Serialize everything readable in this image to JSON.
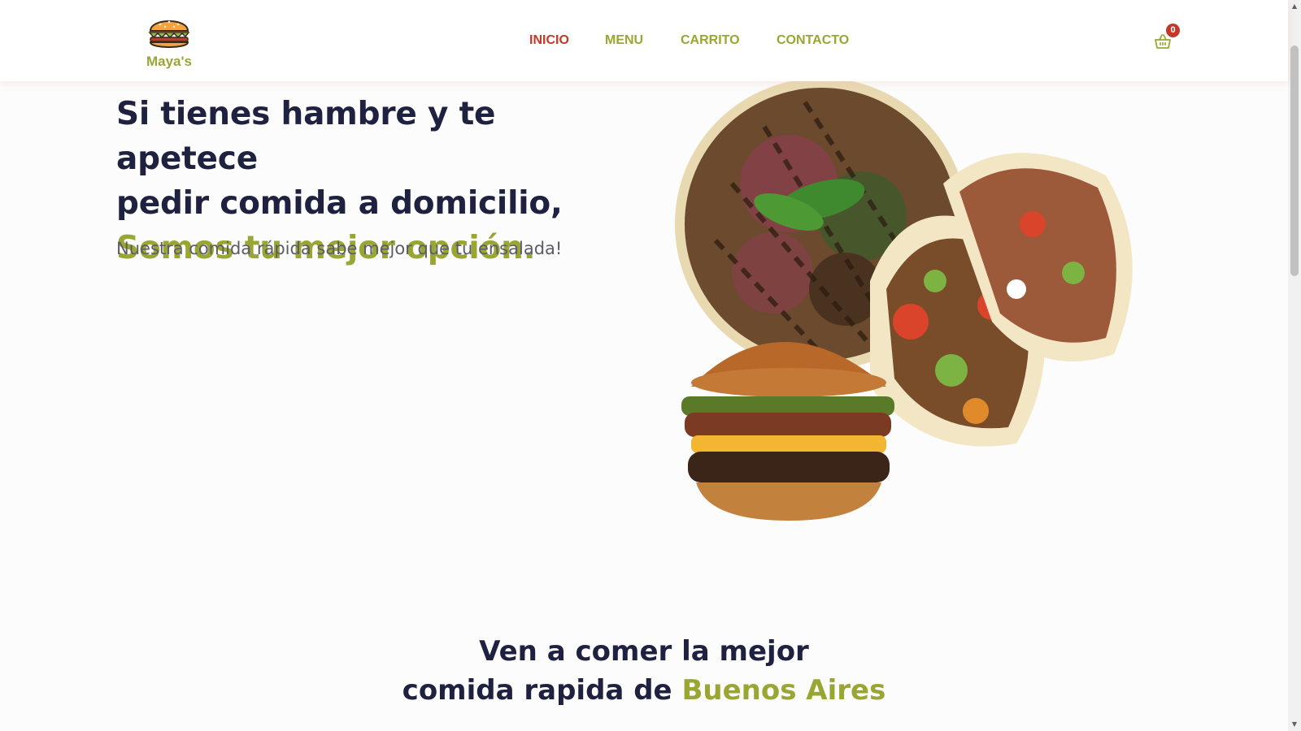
{
  "brand": {
    "name": "Maya's"
  },
  "nav": {
    "items": [
      {
        "label": "INICIO",
        "active": true
      },
      {
        "label": "MENU",
        "active": false
      },
      {
        "label": "CARRITO",
        "active": false
      },
      {
        "label": "CONTACTO",
        "active": false
      }
    ],
    "cart_count": "0"
  },
  "hero": {
    "title_line1": "Si tienes hambre y te apetece",
    "title_line2": "pedir comida a domicilio,",
    "title_accent": "Somos tu mejor opción.",
    "subtitle": "Nuestra comida rápida sabe mejor que tu ensalada!"
  },
  "section": {
    "title_line1": "Ven a comer la mejor",
    "title_line2_prefix": "comida rapida de ",
    "title_line2_accent": "Buenos Aires"
  },
  "colors": {
    "accent": "#9aa634",
    "active_nav": "#c0392b",
    "heading": "#1f2140",
    "background": "#fcfcfc"
  },
  "icons": {
    "logo": "burger-logo-icon",
    "cart": "shopping-basket-icon"
  }
}
